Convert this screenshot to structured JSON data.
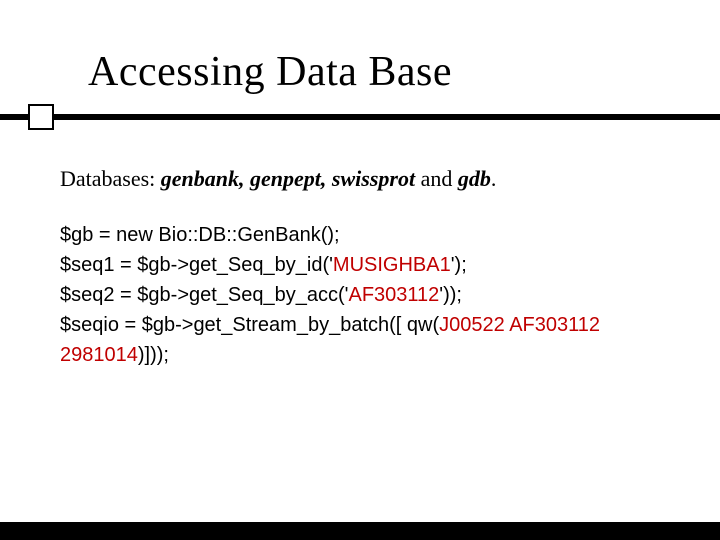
{
  "title": "Accessing Data Base",
  "db_line": {
    "prefix": "Databases: ",
    "list": "genbank, genpept, swissprot",
    "middle": " and ",
    "last": "gdb",
    "suffix": "."
  },
  "code": {
    "l1": "$gb = new Bio::DB::GenBank();",
    "l2a": "$seq1 = $gb->get_Seq_by_id('",
    "l2h": "MUSIGHBA1",
    "l2b": "');",
    "l3a": "$seq2 = $gb->get_Seq_by_acc('",
    "l3h": "AF303112",
    "l3b": "'));",
    "l4a": "$seqio = $gb->get_Stream_by_batch([ qw(",
    "l4h": "J00522 AF303112 2981014",
    "l4b": ")]));"
  }
}
